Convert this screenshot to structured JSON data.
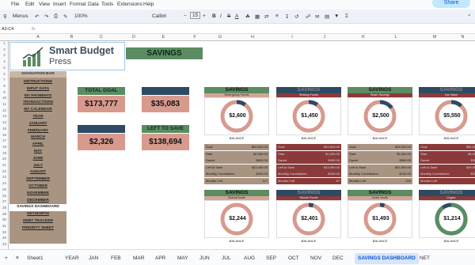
{
  "menubar": {
    "items": [
      "File",
      "Edit",
      "View",
      "Insert",
      "Format",
      "Data",
      "Tools",
      "Extensions",
      "Help"
    ],
    "share_label": "Share"
  },
  "toolbar": {
    "menus_label": "Menus",
    "zoom": "100%",
    "font": "Calibri",
    "font_size": "15",
    "bold": "B",
    "italic": "I",
    "strike": "S",
    "underline_a": "A"
  },
  "formulabar": {
    "cell_ref": "A3:C4",
    "fx": "fx"
  },
  "columns": [
    "A",
    "B",
    "C",
    "D",
    "E",
    "F",
    "G",
    "H",
    "I",
    "J",
    "K",
    "L",
    "M",
    "N",
    "O"
  ],
  "rows": [
    "1",
    "2",
    "3",
    "4",
    "5",
    "6",
    "7",
    "8",
    "9",
    "10",
    "11",
    "12",
    "13",
    "14",
    "15",
    "16",
    "17",
    "18",
    "19",
    "20",
    "21",
    "22",
    "23",
    "24",
    "25",
    "26",
    "27",
    "28",
    "29",
    "30",
    "31",
    "32",
    "33",
    "34"
  ],
  "logo": {
    "title": "Smart Budget",
    "subtitle": "Press"
  },
  "title": "SAVINGS",
  "nav": {
    "header": "NAVIGATION BAR",
    "items": [
      "INSTRUCTIONS",
      "INPUT DATA",
      "MY PAYMENTS",
      "TRANSACTIONS",
      "MY CALENDAR",
      "YEAR",
      "JANUARY",
      "FEBRUARY",
      "MARCH",
      "APRIL",
      "MAY",
      "JUNE",
      "JULY",
      "AUGUST",
      "SEPTEMBER",
      "OCTOBER",
      "NOVEMBER",
      "DECEMBER",
      "SAVINGS DASHBOARD",
      "NETWORTH",
      "DEBT TRACKER",
      "PRIORITY SHEET"
    ]
  },
  "stats": [
    {
      "label": "TOTAL GOAL",
      "value": "$173,777",
      "hdr_color": "#5b8c62"
    },
    {
      "label": "TOTAL SAVED",
      "value": "$35,083",
      "hdr_color": "#2e4a63"
    },
    {
      "label": "TOTAL MONTHLY",
      "value": "$2,326",
      "hdr_color": "#2e4a63"
    },
    {
      "label": "LEFT TO SAVE",
      "value": "$138,694",
      "hdr_color": "#5b8c62"
    }
  ],
  "cards": [
    {
      "title": "SAVINGS",
      "sub": "Emergency Funds",
      "center": "$2,600",
      "hdr_color": "#5b8c62",
      "sub_color": "#d4a496",
      "ring": "#d89a8e",
      "progress": 0.1,
      "balance": "BALANCE",
      "rows": [
        [
          "Goal",
          "$26,000.00"
        ],
        [
          "Start",
          "$2,000.00"
        ],
        [
          "Saved",
          "$600.00"
        ],
        [
          "Left to Save",
          "$23,400.00"
        ],
        [
          "Monthly Contribution",
          "$200.00"
        ],
        [
          "Months Left",
          "117"
        ]
      ]
    },
    {
      "title": "SAVINGS",
      "sub": "Sinking Funds",
      "center": "$1,450",
      "hdr_color": "#2e4a63",
      "sub_color": "#8b3a3a",
      "ring": "#d89a8e",
      "progress": 0.1,
      "balance": "BALANCE",
      "rows": [
        [
          "Goal",
          "$14,500.00"
        ],
        [
          "Start",
          "$1,000.00"
        ],
        [
          "Saved",
          "$450.00"
        ],
        [
          "Left to Save",
          "$13,050.00"
        ],
        [
          "Monthly Contribution",
          "$150.00"
        ],
        [
          "Months Left",
          "87"
        ]
      ]
    },
    {
      "title": "SAVINGS",
      "sub": "Stash Savings",
      "center": "$2,500",
      "hdr_color": "#5b8c62",
      "sub_color": "#8b3a3a",
      "ring": "#d89a8e",
      "progress": 0.15,
      "balance": "BALANCE",
      "rows": [
        [
          "Goal",
          "$25,000.00"
        ],
        [
          "Start",
          "$2,000.00"
        ],
        [
          "Saved",
          "$500.00"
        ],
        [
          "Left to Save",
          "$22,500.00"
        ],
        [
          "Monthly Contribution",
          "$100.00"
        ],
        [
          "Months Left",
          "225"
        ]
      ]
    },
    {
      "title": "SAVINGS",
      "sub": "Car Value",
      "center": "$5,550",
      "hdr_color": "#2e4a63",
      "sub_color": "#8b3a3a",
      "ring": "#d89a8e",
      "progress": 0.12,
      "balance": "BALANCE",
      "rows": [
        [
          "Goal",
          "$55,500.00"
        ],
        [
          "Start",
          "$5,000.00"
        ],
        [
          "Saved",
          "$550.00"
        ],
        [
          "Left to Save",
          "$49,950.00"
        ],
        [
          "Monthly Contribution",
          "$250.00"
        ],
        [
          "Months Left",
          "200"
        ]
      ]
    },
    {
      "title": "SAVINGS",
      "sub": "Mutual funds",
      "center": "$2,244",
      "hdr_color": "#5b8c62",
      "sub_color": "#d4a496",
      "ring": "#d89a8e",
      "progress": 0.0,
      "balance": "BALANCE",
      "rows": []
    },
    {
      "title": "SAVINGS",
      "sub": "Stocks Funds",
      "center": "$2,401",
      "hdr_color": "#2e4a63",
      "sub_color": "#8b3a3a",
      "ring": "#d89a8e",
      "progress": 0.05,
      "balance": "BALANCE",
      "rows": []
    },
    {
      "title": "SAVINGS",
      "sub": "Index funds",
      "center": "$1,493",
      "hdr_color": "#5b8c62",
      "sub_color": "#d4a496",
      "ring": "#d89a8e",
      "progress": 0.05,
      "balance": "BALANCE",
      "rows": []
    },
    {
      "title": "SAVINGS",
      "sub": "Crypto",
      "center": "$1,214",
      "hdr_color": "#2e4a63",
      "sub_color": "#8b3a3a",
      "ring": "#2e4a63",
      "progress": 0.9,
      "balance": "BALANCE",
      "rows": []
    }
  ],
  "sheets": [
    "Sheet1",
    "YEAR",
    "JAN",
    "FEB",
    "MAR",
    "APR",
    "MAY",
    "JUN",
    "JUL",
    "AUG",
    "SEP",
    "OCT",
    "NOV",
    "DEC",
    "SAVINGS DASHBOARD",
    "NET"
  ]
}
